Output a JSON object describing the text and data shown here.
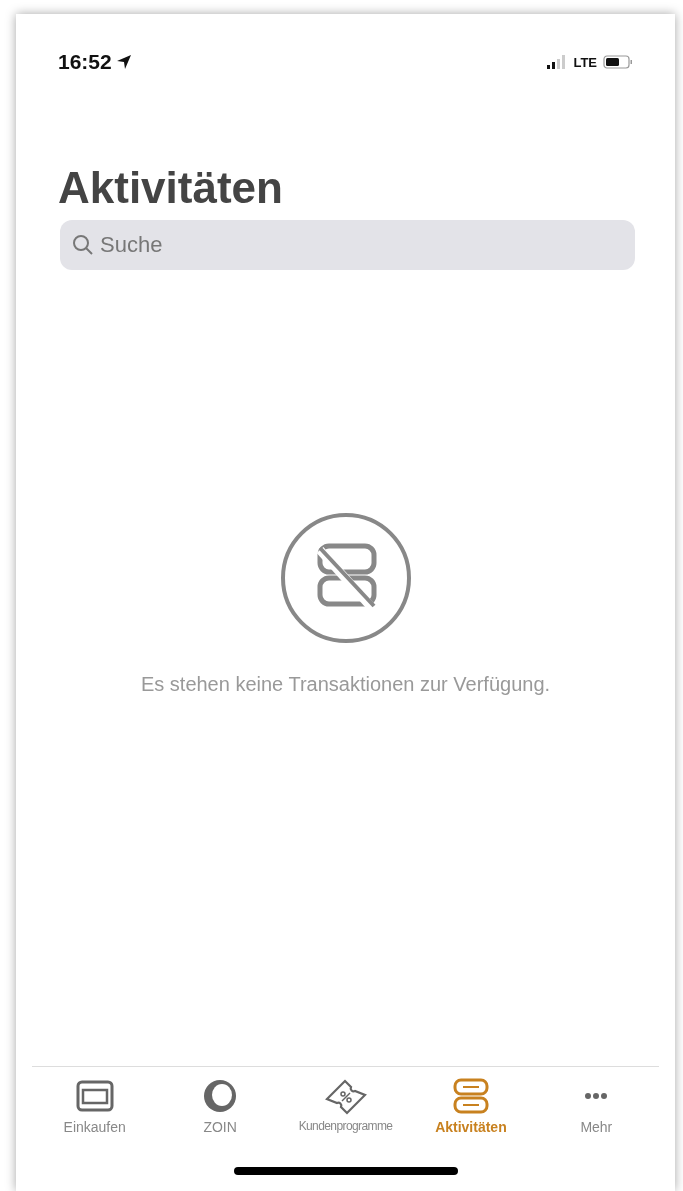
{
  "status_bar": {
    "time": "16:52",
    "network": "LTE"
  },
  "title": "Aktivitäten",
  "search": {
    "placeholder": "Suche"
  },
  "empty_state": {
    "message": "Es stehen keine Transaktionen zur Verfügung."
  },
  "tab_bar": [
    {
      "label": "Einkaufen",
      "kind": "card",
      "selected": false
    },
    {
      "label": "ZOIN",
      "kind": "ring",
      "selected": false
    },
    {
      "label": "Kundenprogramme",
      "kind": "ticket",
      "selected": false
    },
    {
      "label": "Aktivitäten",
      "kind": "stack",
      "selected": true
    },
    {
      "label": "Mehr",
      "kind": "dots",
      "selected": false
    }
  ]
}
